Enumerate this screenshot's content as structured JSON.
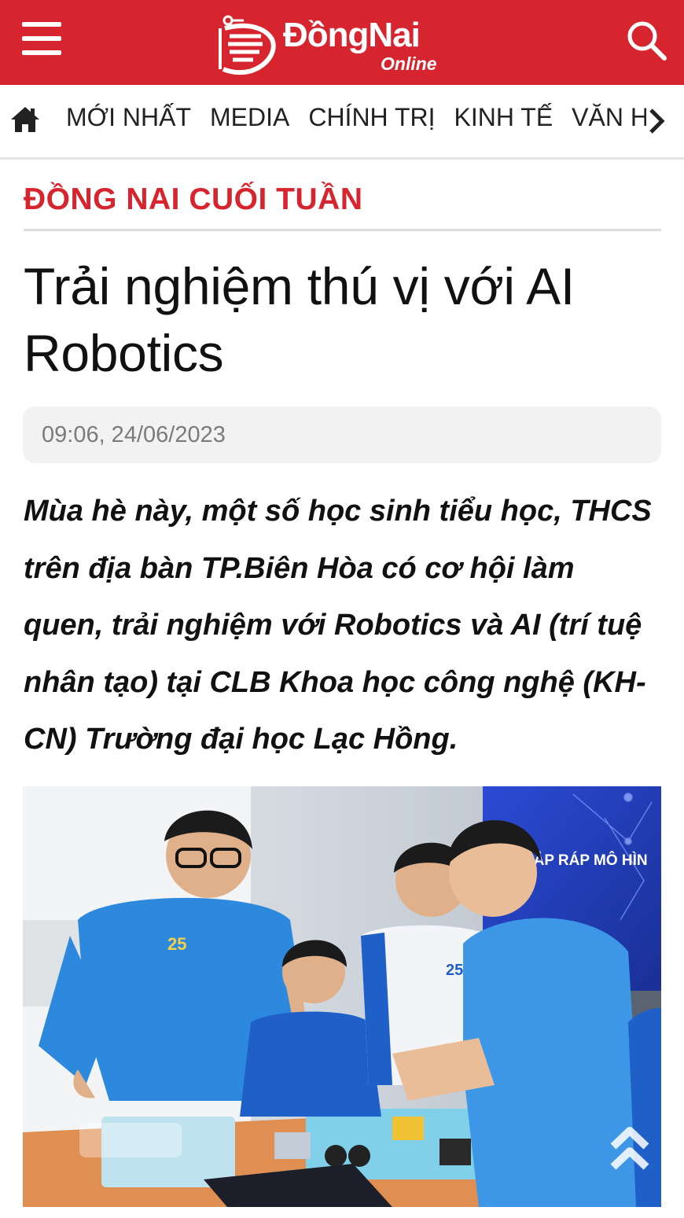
{
  "header": {
    "logo_word": "ĐồngNai",
    "logo_sub": "Online",
    "brand_color": "#d7252f",
    "menu_icon": "hamburger-icon",
    "search_icon": "search-icon"
  },
  "nav": {
    "home_icon": "home-icon",
    "items": [
      "MỚI NHẤT",
      "MEDIA",
      "CHÍNH TRỊ",
      "KINH TẾ",
      "VĂN HÓA"
    ],
    "next_icon": "chevron-right-icon"
  },
  "article": {
    "category": "ĐỒNG NAI CUỐI TUẦN",
    "title": "Trải nghiệm thú vị với AI Robotics",
    "datetime": "09:06, 24/06/2023",
    "sapo": "Mùa hè này, một số học sinh tiểu học, THCS trên địa bàn TP.Biên Hòa có cơ hội làm quen, trải nghiệm với Robotics và AI (trí tuệ nhân tạo) tại CLB Khoa học công nghệ (KH-CN) Trường đại học Lạc Hồng.",
    "photo_banner_text": "LẮP RÁP MÔ HÌN",
    "shirt_logo_text": "25"
  },
  "scroll_top_icon": "double-chevron-up-icon"
}
